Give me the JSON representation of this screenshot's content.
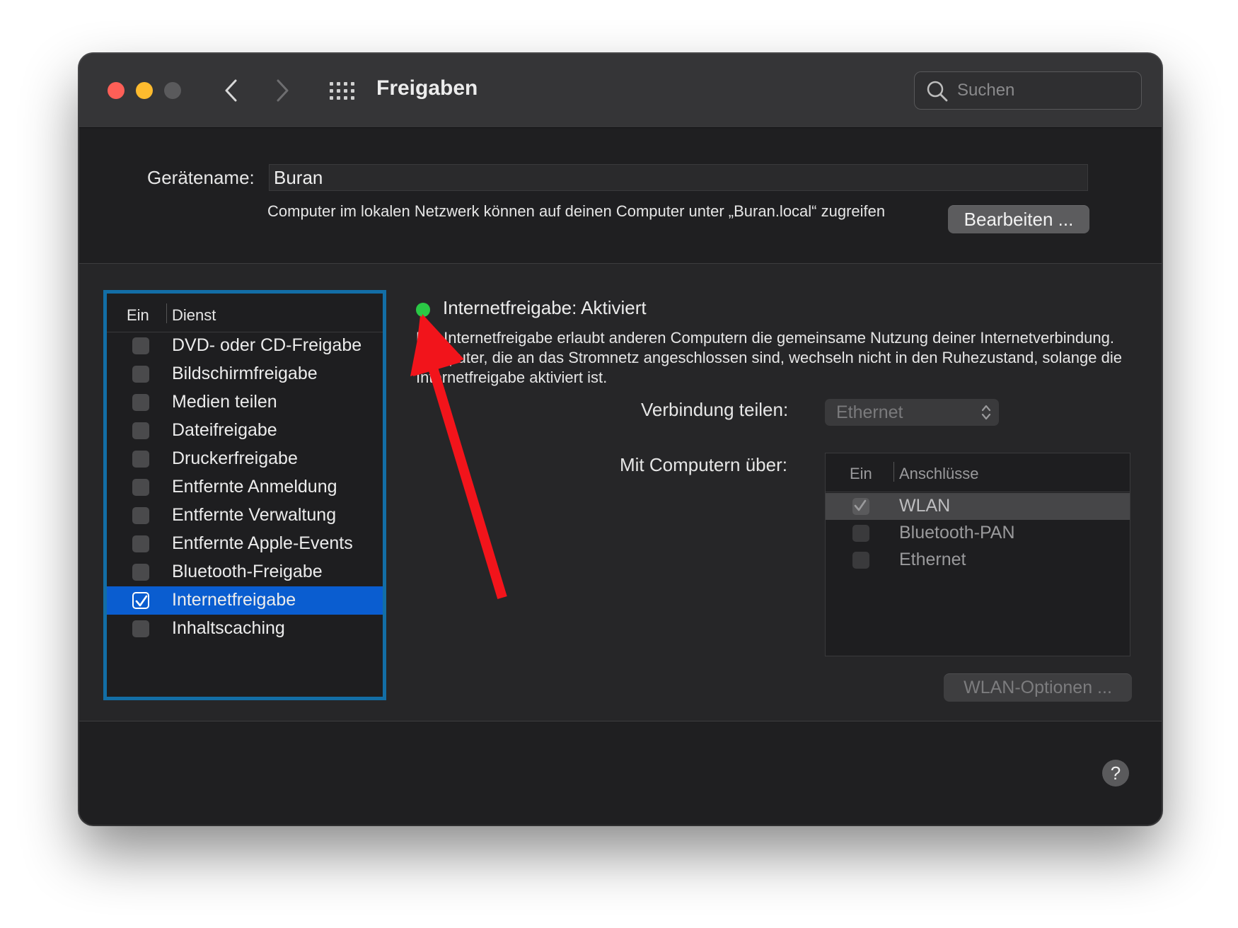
{
  "window": {
    "title": "Freigaben",
    "search_placeholder": "Suchen"
  },
  "device": {
    "name_label": "Gerätename:",
    "name_value": "Buran",
    "info": "Computer im lokalen Netzwerk können auf deinen Computer unter „Buran.local“ zugreifen",
    "edit_button": "Bearbeiten ..."
  },
  "services": {
    "header_on": "Ein",
    "header_service": "Dienst",
    "items": [
      {
        "label": "DVD- oder CD-Freigabe",
        "checked": false,
        "selected": false
      },
      {
        "label": "Bildschirmfreigabe",
        "checked": false,
        "selected": false
      },
      {
        "label": "Medien teilen",
        "checked": false,
        "selected": false
      },
      {
        "label": "Dateifreigabe",
        "checked": false,
        "selected": false
      },
      {
        "label": "Druckerfreigabe",
        "checked": false,
        "selected": false
      },
      {
        "label": "Entfernte Anmeldung",
        "checked": false,
        "selected": false
      },
      {
        "label": "Entfernte Verwaltung",
        "checked": false,
        "selected": false
      },
      {
        "label": "Entfernte Apple-Events",
        "checked": false,
        "selected": false
      },
      {
        "label": "Bluetooth-Freigabe",
        "checked": false,
        "selected": false
      },
      {
        "label": "Internetfreigabe",
        "checked": true,
        "selected": true
      },
      {
        "label": "Inhaltscaching",
        "checked": false,
        "selected": false
      }
    ]
  },
  "detail": {
    "status": "Internetfreigabe: Aktiviert",
    "status_color": "#2ac845",
    "description": "Die Internetfreigabe erlaubt anderen Computern die gemeinsame Nutzung deiner Internetverbindung. Computer, die an das Stromnetz angeschlossen sind, wechseln nicht in den Ruhezustand, solange die Internetfreigabe aktiviert ist.",
    "share_label": "Verbindung teilen:",
    "share_value": "Ethernet",
    "ports_label": "Mit Computern über:",
    "ports_header_on": "Ein",
    "ports_header_ports": "Anschlüsse",
    "ports": [
      {
        "label": "WLAN",
        "checked": true,
        "highlighted": true
      },
      {
        "label": "Bluetooth-PAN",
        "checked": false,
        "highlighted": false
      },
      {
        "label": "Ethernet",
        "checked": false,
        "highlighted": false
      }
    ],
    "wlan_button": "WLAN-Optionen ..."
  },
  "help_label": "?",
  "colors": {
    "selection": "#0a5dd0",
    "list_border": "#136ea6",
    "annotation_arrow": "#f2141b"
  }
}
